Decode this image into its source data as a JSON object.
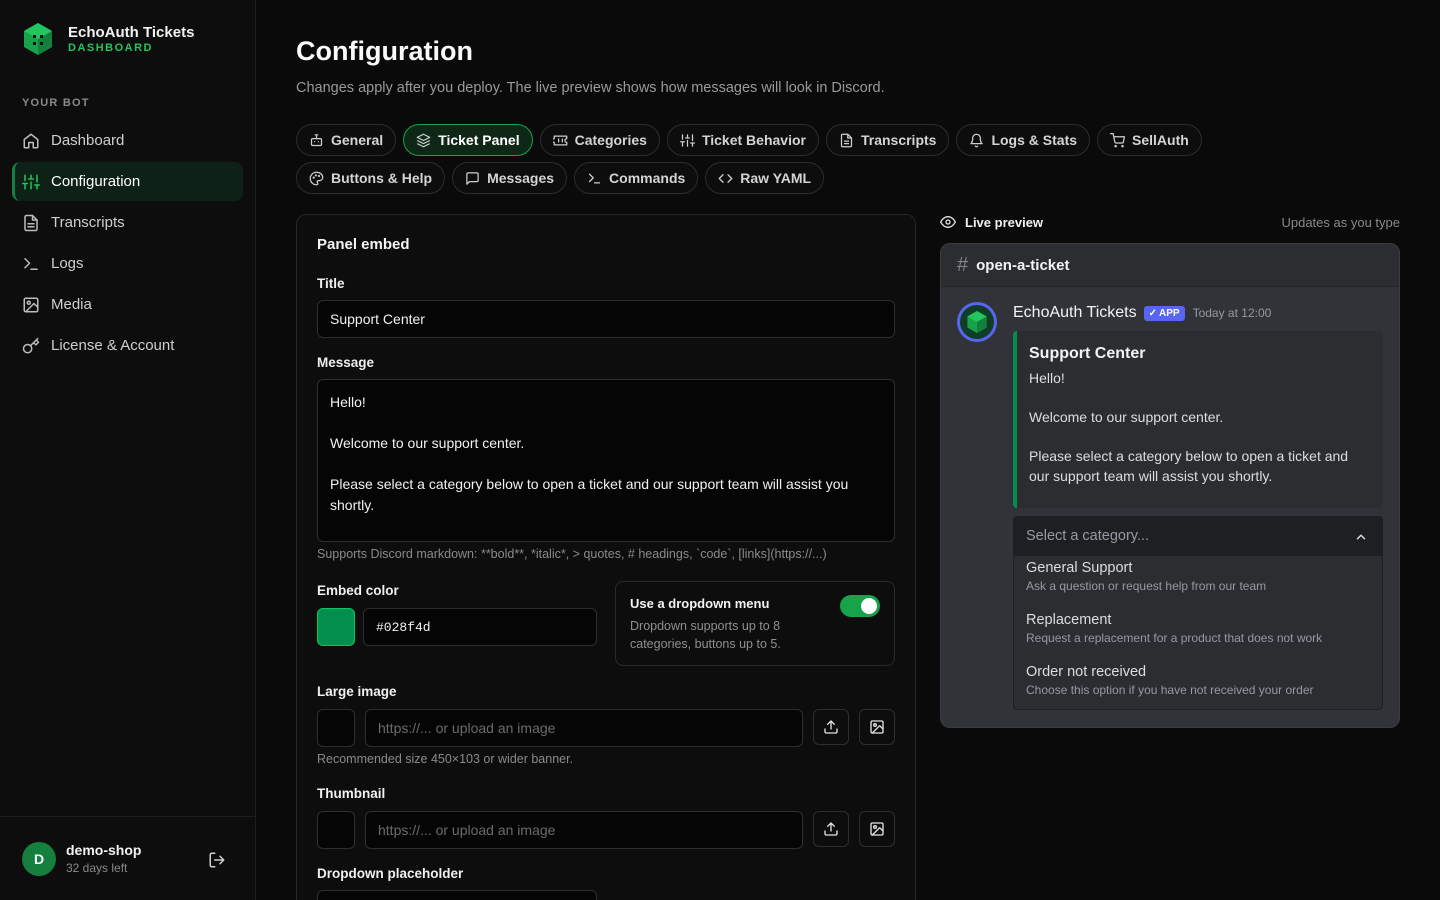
{
  "brand": {
    "title": "EchoAuth Tickets",
    "subtitle": "DASHBOARD",
    "logo_icon": "cube-icon",
    "accent": "#22c55e"
  },
  "sidebar": {
    "section_label": "YOUR BOT",
    "items": [
      {
        "label": "Dashboard",
        "icon": "home-icon",
        "active": false
      },
      {
        "label": "Configuration",
        "icon": "sliders-icon",
        "active": true
      },
      {
        "label": "Transcripts",
        "icon": "file-icon",
        "active": false
      },
      {
        "label": "Logs",
        "icon": "terminal-icon",
        "active": false
      },
      {
        "label": "Media",
        "icon": "image-icon",
        "active": false
      },
      {
        "label": "License & Account",
        "icon": "key-icon",
        "active": false
      }
    ],
    "user": {
      "initial": "D",
      "name": "demo-shop",
      "sub": "32 days left"
    }
  },
  "header": {
    "title": "Configuration",
    "subtitle": "Changes apply after you deploy. The live preview shows how messages will look in Discord."
  },
  "tabs": [
    {
      "label": "General",
      "icon": "robot-icon",
      "active": false
    },
    {
      "label": "Ticket Panel",
      "icon": "layers-icon",
      "active": true
    },
    {
      "label": "Categories",
      "icon": "ticket-icon",
      "active": false
    },
    {
      "label": "Ticket Behavior",
      "icon": "sliders-icon",
      "active": false
    },
    {
      "label": "Transcripts",
      "icon": "file-icon",
      "active": false
    },
    {
      "label": "Logs & Stats",
      "icon": "bell-icon",
      "active": false
    },
    {
      "label": "SellAuth",
      "icon": "cart-icon",
      "active": false
    },
    {
      "label": "Buttons & Help",
      "icon": "palette-icon",
      "active": false
    },
    {
      "label": "Messages",
      "icon": "message-icon",
      "active": false
    },
    {
      "label": "Commands",
      "icon": "terminal-icon",
      "active": false
    },
    {
      "label": "Raw YAML",
      "icon": "code-icon",
      "active": false
    }
  ],
  "form": {
    "card_title": "Panel embed",
    "title_label": "Title",
    "title_value": "Support Center",
    "message_label": "Message",
    "message_lines": [
      "Hello!",
      "",
      "Welcome to our support center.",
      "",
      "Please select a category below to open a ticket and our support team will assist you shortly."
    ],
    "markdown_help": "Supports Discord markdown: **bold**, *italic*, > quotes, # headings, `code`, [links](https://...)",
    "color_label": "Embed color",
    "color_value": "#028f4d",
    "dropdown_toggle": {
      "title": "Use a dropdown menu",
      "desc": "Dropdown supports up to 8 categories, buttons up to 5.",
      "on": true
    },
    "large_image_label": "Large image",
    "large_image_placeholder": "https://... or upload an image",
    "large_image_help": "Recommended size 450×103 or wider banner.",
    "thumbnail_label": "Thumbnail",
    "thumbnail_placeholder": "https://... or upload an image",
    "dropdown_placeholder_label": "Dropdown placeholder"
  },
  "preview": {
    "label": "Live preview",
    "note": "Updates as you type",
    "channel": "open-a-ticket",
    "bot_name": "EchoAuth Tickets",
    "badge": "APP",
    "time": "Today at 12:00",
    "embed_title": "Support Center",
    "embed_lines": [
      "Hello!",
      "",
      "Welcome to our support center.",
      "",
      "Please select a category below to open a ticket and our support team will assist you shortly."
    ],
    "select_placeholder": "Select a category...",
    "options": [
      {
        "label": "General Support",
        "desc": "Ask a question or request help from our team"
      },
      {
        "label": "Replacement",
        "desc": "Request a replacement for a product that does not work"
      },
      {
        "label": "Order not received",
        "desc": "Choose this option if you have not received your order"
      }
    ]
  }
}
